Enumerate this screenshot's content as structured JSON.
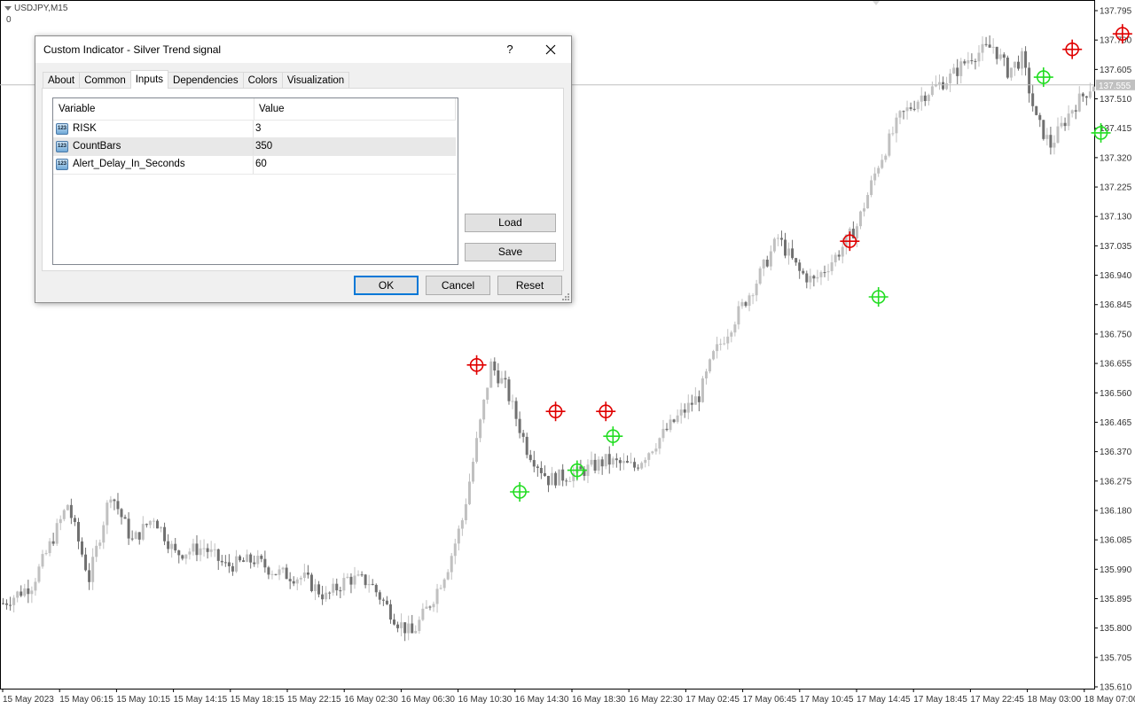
{
  "chart": {
    "symbol": "USDJPY,M15",
    "indicator_value": "0",
    "current_price": "137.555",
    "price_labels": [
      "137.795",
      "137.700",
      "137.605",
      "137.510",
      "137.415",
      "137.320",
      "137.225",
      "137.130",
      "137.035",
      "136.940",
      "136.845",
      "136.750",
      "136.655",
      "136.560",
      "136.465",
      "136.370",
      "136.275",
      "136.180",
      "136.085",
      "135.990",
      "135.895",
      "135.800",
      "135.705",
      "135.610"
    ],
    "time_labels": [
      "15 May 2023",
      "15 May 06:15",
      "15 May 10:15",
      "15 May 14:15",
      "15 May 18:15",
      "15 May 22:15",
      "16 May 02:30",
      "16 May 06:30",
      "16 May 10:30",
      "16 May 14:30",
      "16 May 18:30",
      "16 May 22:30",
      "17 May 02:45",
      "17 May 06:45",
      "17 May 10:45",
      "17 May 14:45",
      "17 May 18:45",
      "17 May 22:45",
      "18 May 03:00",
      "18 May 07:00"
    ],
    "colors": {
      "bull": "#c0c0c0",
      "bear": "#707070",
      "sell_signal": "#e00000",
      "buy_signal": "#22dd22",
      "grid_line": "#c0c0c0"
    },
    "sell_signals": [
      [
        66,
        136.65
      ],
      [
        77,
        136.5
      ],
      [
        84,
        136.5
      ],
      [
        118,
        137.05
      ],
      [
        149,
        137.67
      ],
      [
        156,
        137.72
      ]
    ],
    "buy_signals": [
      [
        72,
        136.24
      ],
      [
        80,
        136.31
      ],
      [
        85,
        136.42
      ],
      [
        122,
        136.87
      ],
      [
        145,
        137.58
      ],
      [
        153,
        137.4
      ]
    ]
  },
  "dialog": {
    "title": "Custom Indicator - Silver Trend signal",
    "help": "?",
    "tabs": [
      "About",
      "Common",
      "Inputs",
      "Dependencies",
      "Colors",
      "Visualization"
    ],
    "active_tab": "Inputs",
    "columns": {
      "variable": "Variable",
      "value": "Value"
    },
    "params": [
      {
        "name": "RISK",
        "value": "3",
        "icon": "123"
      },
      {
        "name": "CountBars",
        "value": "350",
        "icon": "123"
      },
      {
        "name": "Alert_Delay_In_Seconds",
        "value": "60",
        "icon": "123"
      }
    ],
    "load_label": "Load",
    "save_label": "Save",
    "ok_label": "OK",
    "cancel_label": "Cancel",
    "reset_label": "Reset"
  }
}
